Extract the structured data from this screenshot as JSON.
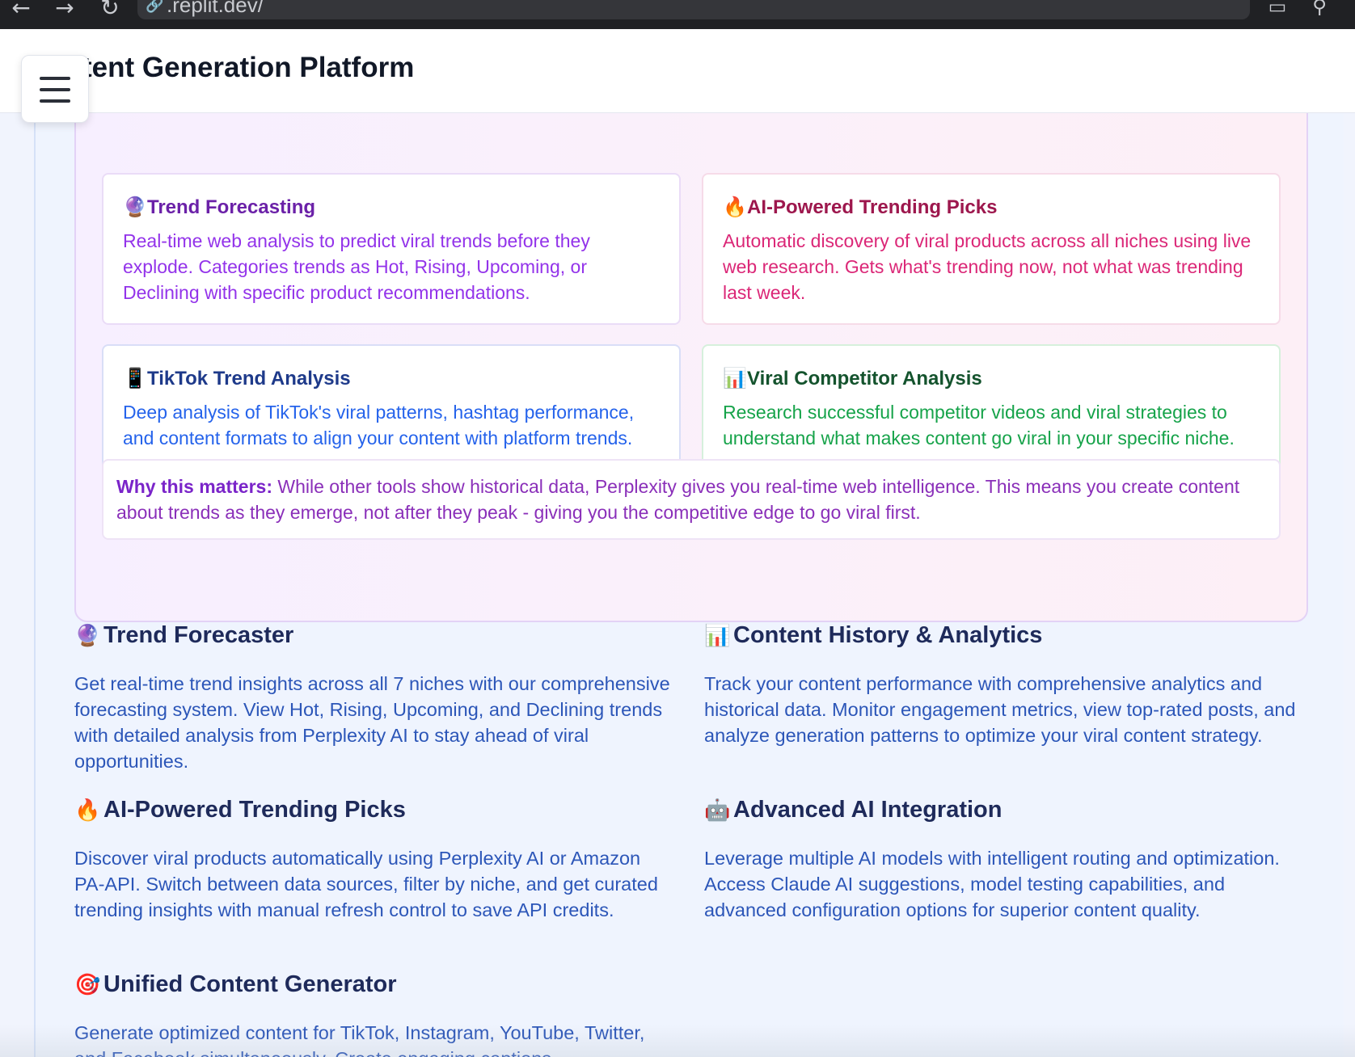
{
  "browser": {
    "url": ".replit.dev/",
    "back_icon": "arrow-left-icon",
    "forward_icon": "arrow-right-icon",
    "reload_icon": "reload-icon"
  },
  "header": {
    "title": "tent Generation Platform",
    "menu_icon": "hamburger-icon"
  },
  "perplexity_box": {
    "cards": [
      {
        "emoji": "🔮",
        "title": "Trend Forecasting",
        "description": "Real-time web analysis to predict viral trends before they explode. Categories trends as Hot, Rising, Upcoming, or Declining with specific product recommendations.",
        "title_color": "#6b21a8",
        "text_color": "#9333ea"
      },
      {
        "emoji": "🔥",
        "title": "AI-Powered Trending Picks",
        "description": "Automatic discovery of viral products across all niches using live web research. Gets what's trending now, not what was trending last week.",
        "title_color": "#9d174d",
        "text_color": "#db2777"
      },
      {
        "emoji": "📱",
        "title": "TikTok Trend Analysis",
        "description": "Deep analysis of TikTok's viral patterns, hashtag performance, and content formats to align your content with platform trends.",
        "title_color": "#1e3a8a",
        "text_color": "#2563eb"
      },
      {
        "emoji": "📊",
        "title": "Viral Competitor Analysis",
        "description": "Research successful competitor videos and viral strategies to understand what makes content go viral in your specific niche.",
        "title_color": "#14532d",
        "text_color": "#16a34a"
      }
    ],
    "why_label": "Why this matters:",
    "why_text": " While other tools show historical data, Perplexity gives you real-time web intelligence. This means you create content about trends as they emerge, not after they peak - giving you the competitive edge to go viral first."
  },
  "sections": [
    {
      "emoji": "🔮",
      "title": "Trend Forecaster",
      "description": "Get real-time trend insights across all 7 niches with our comprehensive forecasting system. View Hot, Rising, Upcoming, and Declining trends with detailed analysis from Perplexity AI to stay ahead of viral opportunities."
    },
    {
      "emoji": "📊",
      "title": "Content History & Analytics",
      "description": "Track your content performance with comprehensive analytics and historical data. Monitor engagement metrics, view top-rated posts, and analyze generation patterns to optimize your viral content strategy."
    },
    {
      "emoji": "🔥",
      "title": "AI-Powered Trending Picks",
      "description": "Discover viral products automatically using Perplexity AI or Amazon PA-API. Switch between data sources, filter by niche, and get curated trending insights with manual refresh control to save API credits."
    },
    {
      "emoji": "🤖",
      "title": "Advanced AI Integration",
      "description": "Leverage multiple AI models with intelligent routing and optimization. Access Claude AI suggestions, model testing capabilities, and advanced configuration options for superior content quality."
    },
    {
      "emoji": "🎯",
      "title": "Unified Content Generator",
      "description": "Generate optimized content for TikTok, Instagram, YouTube, Twitter, and Facebook simultaneously. Create engaging captions"
    }
  ]
}
